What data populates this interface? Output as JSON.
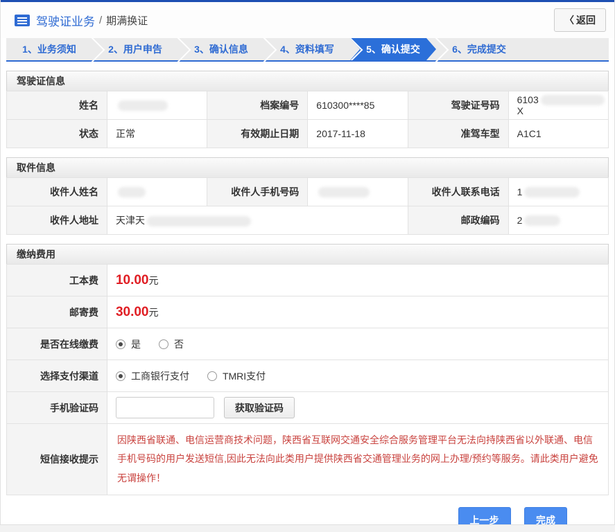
{
  "header": {
    "title": "驾驶证业务",
    "crumb_sep": "/",
    "subtitle": "期满换证",
    "back_chevron": "〈",
    "back_label": "返回"
  },
  "steps": {
    "items": [
      {
        "label": "1、业务须知",
        "active": false
      },
      {
        "label": "2、用户申告",
        "active": false
      },
      {
        "label": "3、确认信息",
        "active": false
      },
      {
        "label": "4、资料填写",
        "active": false
      },
      {
        "label": "5、确认提交",
        "active": true
      },
      {
        "label": "6、完成提交",
        "active": false
      }
    ]
  },
  "license": {
    "title": "驾驶证信息",
    "name_label": "姓名",
    "file_no_label": "档案编号",
    "file_no": "610300****85",
    "license_no_label": "驾驶证号码",
    "license_no_prefix": "6103",
    "license_no_suffix": "X",
    "status_label": "状态",
    "status": "正常",
    "expiry_label": "有效期止日期",
    "expiry": "2017-11-18",
    "class_label": "准驾车型",
    "class": "A1C1"
  },
  "pickup": {
    "title": "取件信息",
    "recipient_label": "收件人姓名",
    "phone_label": "收件人手机号码",
    "tel_label": "收件人联系电话",
    "tel_prefix": "1",
    "address_label": "收件人地址",
    "address_prefix": "天津天",
    "zip_label": "邮政编码",
    "zip_prefix": "2"
  },
  "fees": {
    "title": "缴纳费用",
    "work_fee_label": "工本费",
    "work_fee": "10.00",
    "mail_fee_label": "邮寄费",
    "mail_fee": "30.00",
    "yuan": "元",
    "online_label": "是否在线缴费",
    "yes_label": "是",
    "no_label": "否",
    "channel_label": "选择支付渠道",
    "channel_icbc": "工商银行支付",
    "channel_tmri": "TMRI支付",
    "captcha_label": "手机验证码",
    "captcha_value": "",
    "captcha_button": "获取验证码",
    "notice_label": "短信接收提示",
    "notice_text": "因陕西省联通、电信运营商技术问题，陕西省互联网交通安全综合服务管理平台无法向持陕西省以外联通、电信手机号码的用户发送短信,因此无法向此类用户提供陕西省交通管理业务的网上办理/预约等服务。请此类用户避免无谓操作！"
  },
  "footer": {
    "prev_label": "上一步",
    "done_label": "完成"
  },
  "colors": {
    "topline_blue": "#1d4fb2",
    "accent_blue": "#2f6bd3",
    "active_tab_blue": "#2b6fd9",
    "button_blue": "#4a8cf0",
    "price_red": "#e01e24",
    "notice_red": "#c9433f",
    "label_bg": "#f4f4f4",
    "tab_bar_bg": "#ebebeb"
  }
}
